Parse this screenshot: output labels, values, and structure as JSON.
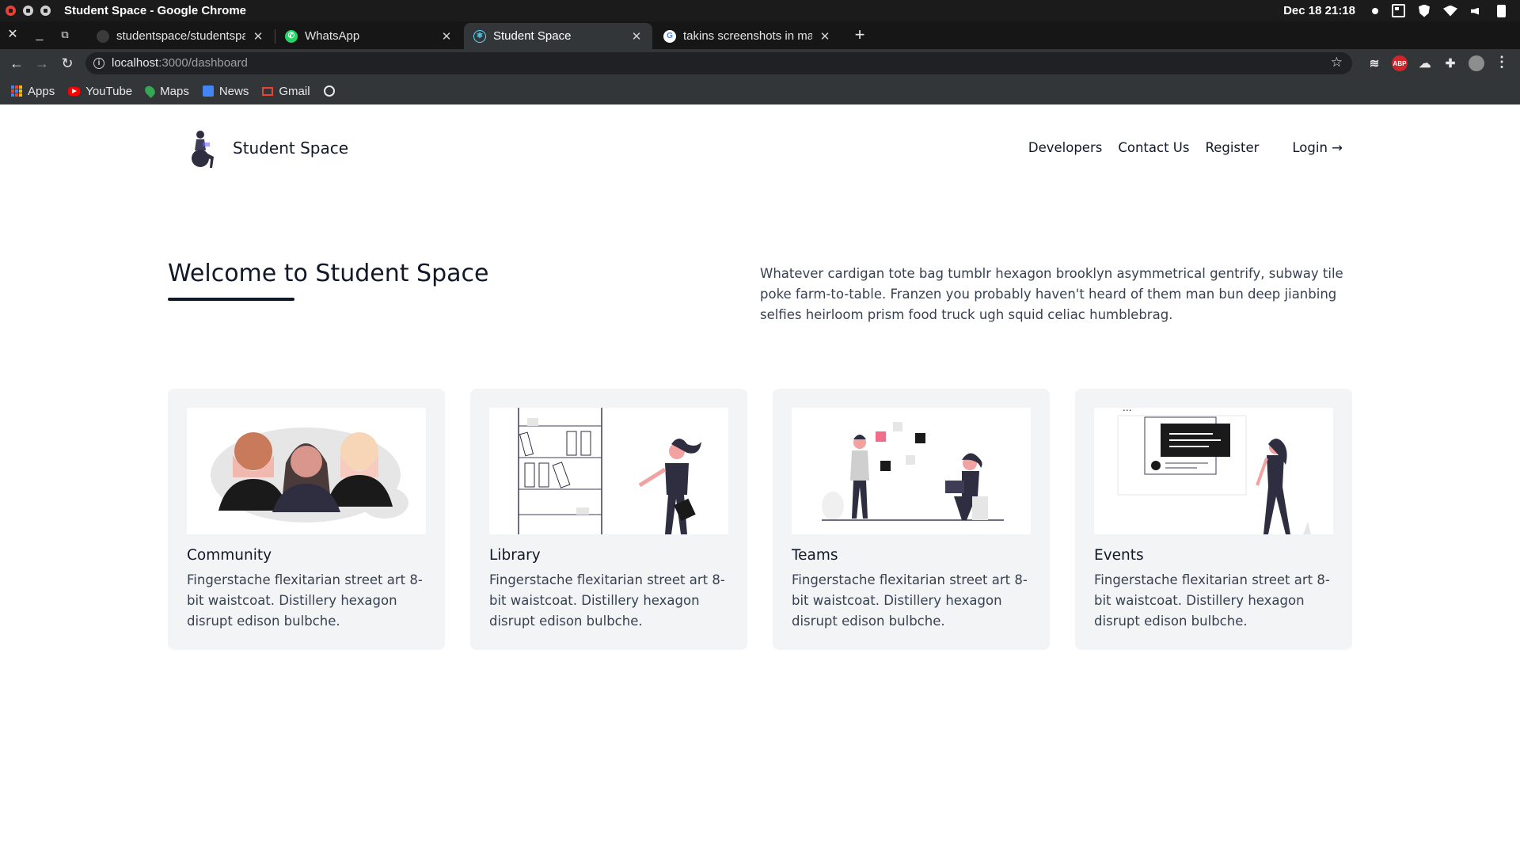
{
  "os": {
    "window_title": "Student Space - Google Chrome",
    "datetime": "Dec 18  21:18"
  },
  "tabs": [
    {
      "label": "studentspace/studentspa",
      "active": false,
      "icon": "github-icon"
    },
    {
      "label": "WhatsApp",
      "active": false,
      "icon": "whatsapp-icon"
    },
    {
      "label": "Student Space",
      "active": true,
      "icon": "react-icon"
    },
    {
      "label": "takins screenshots in ma",
      "active": false,
      "icon": "google-icon"
    }
  ],
  "address": {
    "url_host": "localhost",
    "url_path": ":3000/dashboard"
  },
  "bookmarks": [
    {
      "label": "Apps",
      "icon": "apps-grid-icon"
    },
    {
      "label": "YouTube",
      "icon": "youtube-icon"
    },
    {
      "label": "Maps",
      "icon": "maps-icon"
    },
    {
      "label": "News",
      "icon": "news-icon"
    },
    {
      "label": "Gmail",
      "icon": "gmail-icon"
    },
    {
      "label": "",
      "icon": "globe-icon"
    }
  ],
  "site": {
    "brand": "Student Space",
    "nav": {
      "developers": "Developers",
      "contact": "Contact Us",
      "register": "Register",
      "login": "Login →"
    }
  },
  "hero": {
    "title": "Welcome to Student Space",
    "text": "Whatever cardigan tote bag tumblr hexagon brooklyn asymmetrical gentrify, subway tile poke farm-to-table. Franzen you probably haven't heard of them man bun deep jianbing selfies heirloom prism food truck ugh squid celiac humblebrag."
  },
  "cards": [
    {
      "title": "Community",
      "desc": "Fingerstache flexitarian street art 8-bit waistcoat. Distillery hexagon disrupt edison bulbche."
    },
    {
      "title": "Library",
      "desc": "Fingerstache flexitarian street art 8-bit waistcoat. Distillery hexagon disrupt edison bulbche."
    },
    {
      "title": "Teams",
      "desc": "Fingerstache flexitarian street art 8-bit waistcoat. Distillery hexagon disrupt edison bulbche."
    },
    {
      "title": "Events",
      "desc": "Fingerstache flexitarian street art 8-bit waistcoat. Distillery hexagon disrupt edison bulbche."
    }
  ],
  "colors": {
    "accent_pink": "#f26d8a",
    "dark_ink": "#2f2e41",
    "card_bg": "#f3f4f6"
  }
}
